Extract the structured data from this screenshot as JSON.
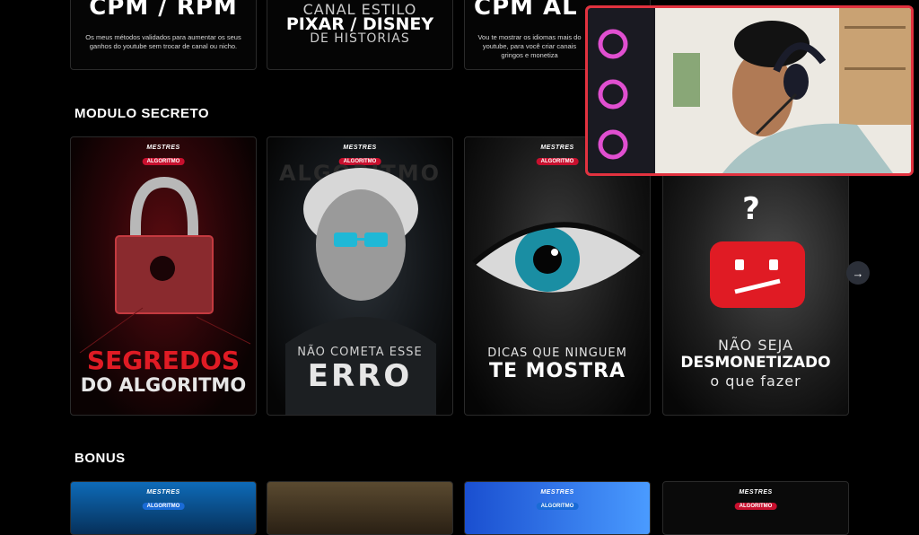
{
  "top_row": [
    {
      "title": "CPM / RPM",
      "desc": "Os meus métodos validados para aumentar os seus ganhos do youtube sem trocar de canal ou nicho."
    },
    {
      "line1": "CANAL ESTILO",
      "line2": "PIXAR / DISNEY",
      "line3": "DE HISTORIAS"
    },
    {
      "title": "CPM AL",
      "desc": "Vou te mostrar os idiomas mais do youtube, para você criar canais gringos e monetiza"
    }
  ],
  "sections": {
    "modulo": "MODULO SECRETO",
    "bonus": "BONUS"
  },
  "brand": {
    "line1": "MESTRES",
    "line2": "ALGORITMO"
  },
  "modules": [
    {
      "line1": "SEGREDOS",
      "line2": "DO ALGORITMO",
      "accent": "#e01b24"
    },
    {
      "line1": "NÃO COMETA ESSE",
      "line2": "ERRO",
      "overlay": "ALGORITMO",
      "accent": "#21c4e0"
    },
    {
      "line1": "DICAS QUE NINGUEM",
      "line2": "TE MOSTRA",
      "accent": "#1fb3c9"
    },
    {
      "line1": "NÃO SEJA",
      "line2": "DESMONETIZADO",
      "line3": "o que fazer",
      "symbol": "?",
      "accent": "#e01b24"
    }
  ],
  "next_icon": "arrow-right-icon"
}
